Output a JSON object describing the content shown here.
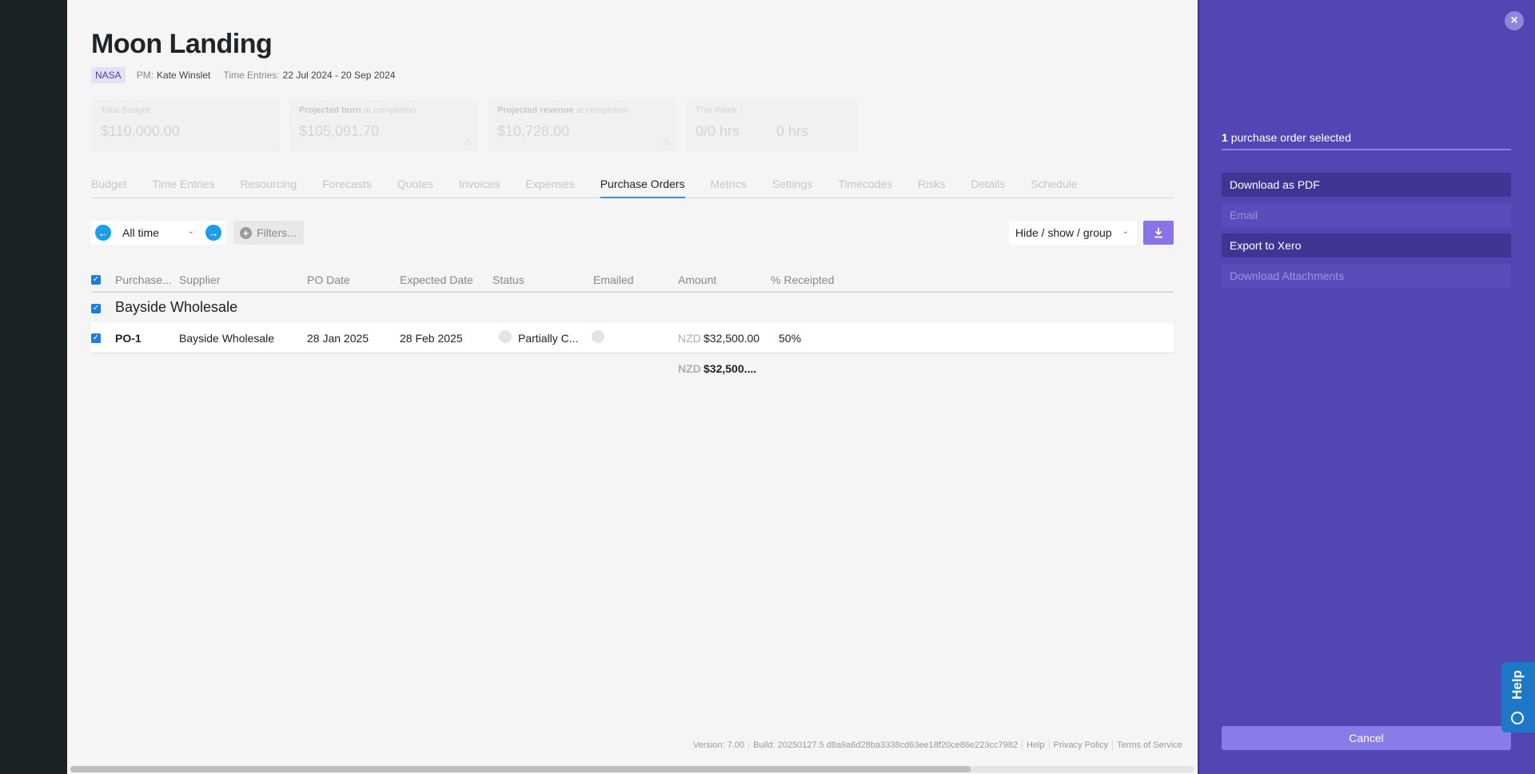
{
  "project": {
    "title": "Moon Landing",
    "client": "NASA",
    "pm_label": "PM:",
    "pm_name": "Kate Winslet",
    "time_entries_label": "Time Entries:",
    "time_entries_range": "22 Jul 2024 - 20 Sep 2024"
  },
  "cards": {
    "total_budget_label": "Total Budget",
    "total_budget_value": "$110,000.00",
    "burn_label_bold": "Projected burn",
    "burn_label_rest": "at completion",
    "burn_value": "$105,091.70",
    "revenue_label_bold": "Projected revenue",
    "revenue_label_rest": "at completion",
    "revenue_value": "$10,728.00",
    "week_label": "This Week",
    "week_hours": "0/0 hrs",
    "week_other": "0 hrs"
  },
  "tabs": [
    "Budget",
    "Time Entries",
    "Resourcing",
    "Forecasts",
    "Quotes",
    "Invoices",
    "Expenses",
    "Purchase Orders",
    "Metrics",
    "Settings",
    "Timecodes",
    "Risks",
    "Details",
    "Schedule"
  ],
  "active_tab": "Purchase Orders",
  "toolbar": {
    "range": "All time",
    "filters": "Filters...",
    "hide_show_group": "Hide / show / group"
  },
  "table": {
    "columns": {
      "purchase": "Purchase...",
      "supplier": "Supplier",
      "po_date": "PO Date",
      "expected_date": "Expected Date",
      "status": "Status",
      "emailed": "Emailed",
      "amount": "Amount",
      "receipted": "% Receipted"
    },
    "group_name": "Bayside Wholesale",
    "row": {
      "po": "PO-1",
      "supplier": "Bayside Wholesale",
      "po_date": "28 Jan 2025",
      "expected_date": "28 Feb 2025",
      "status": "Partially C...",
      "currency": "NZD",
      "amount": "$32,500.00",
      "receipted": "50%"
    },
    "total_currency": "NZD",
    "total_amount": "$32,500...."
  },
  "footer": {
    "version": "Version: 7.00",
    "build": "Build: 20250127.5 d8a9a6d28ba3338cd63ee18f20ce86e223cc7982",
    "help": "Help",
    "privacy": "Privacy Policy",
    "terms": "Terms of Service"
  },
  "panel": {
    "selected_count": "1",
    "selected_text": "purchase order selected",
    "actions": {
      "download_pdf": "Download as PDF",
      "email": "Email",
      "export_xero": "Export to Xero",
      "download_attachments": "Download Attachments"
    },
    "cancel": "Cancel",
    "help_tab": "Help"
  },
  "colors": {
    "panel_bg": "#5146b4",
    "accent_blue": "#1e9de7",
    "button_purple": "#8a73e8"
  }
}
